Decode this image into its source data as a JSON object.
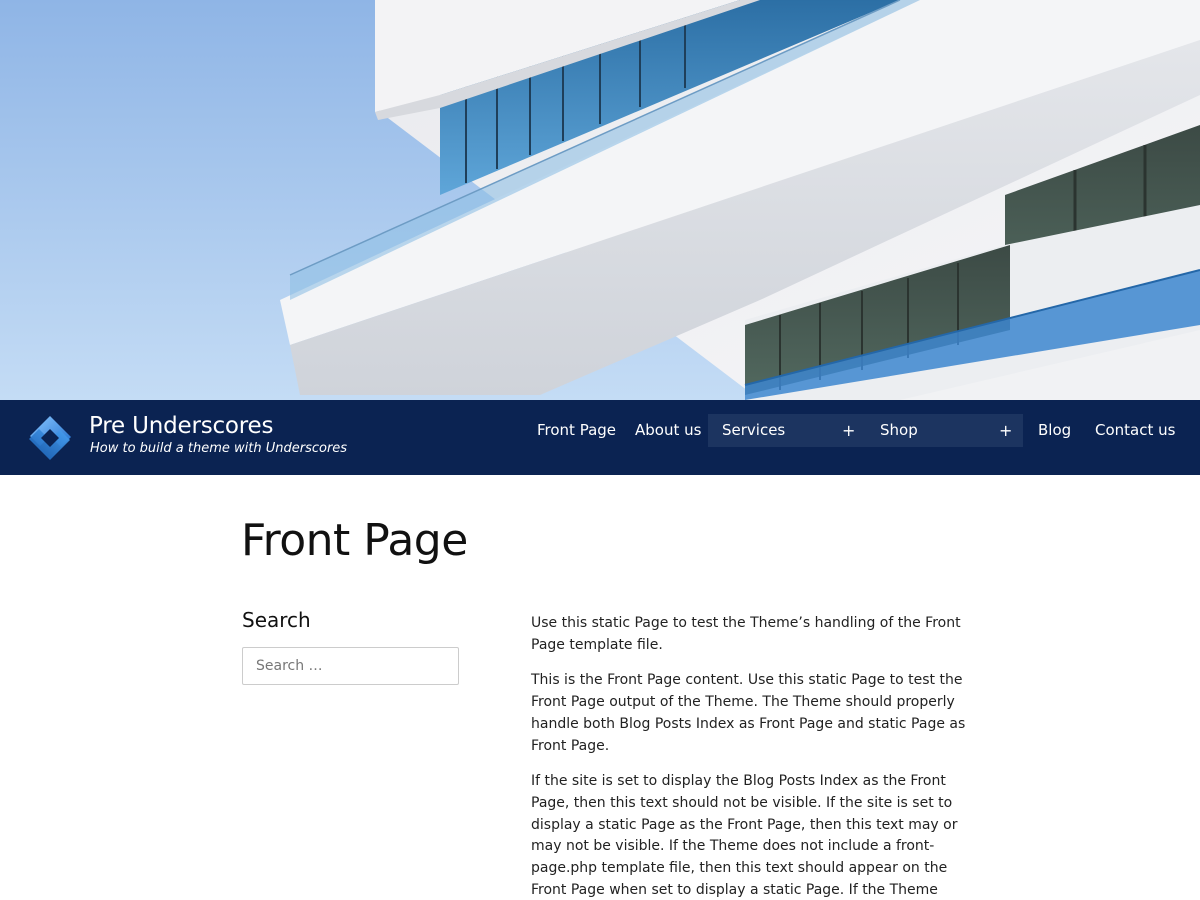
{
  "site": {
    "title": "Pre Underscores",
    "description": "How to build a theme with Underscores"
  },
  "nav": {
    "items": [
      {
        "label": "Front Page"
      },
      {
        "label": "About us"
      },
      {
        "label": "Services",
        "has_submenu": true
      },
      {
        "label": "Shop",
        "has_submenu": true
      },
      {
        "label": "Blog"
      },
      {
        "label": "Contact us"
      }
    ],
    "expand_symbol": "+"
  },
  "page": {
    "title": "Front Page"
  },
  "sidebar": {
    "widget_title": "Search",
    "search_placeholder": "Search …"
  },
  "content": {
    "paragraphs": [
      "Use this static Page to test the Theme’s handling of the Front Page template file.",
      "This is the Front Page content. Use this static Page to test the Front Page output of the Theme. The Theme should properly handle both Blog Posts Index as Front Page and static Page as Front Page.",
      "If the site is set to display the Blog Posts Index as the Front Page, then this text should not be visible. If the site is set to display a static Page as the Front Page, then this text may or may not be visible. If the Theme does not include a front-page.php template file, then this text should appear on the Front Page when set to display a static Page. If the Theme does include a front-page.php"
    ]
  },
  "colors": {
    "navbar_bg": "#0b2352",
    "submenu_item_bg": "#1c3460",
    "sky": "#a9c9ec",
    "logo_blue": "#2f8be0"
  },
  "icons": {
    "logo": "diamond-logo-icon"
  }
}
